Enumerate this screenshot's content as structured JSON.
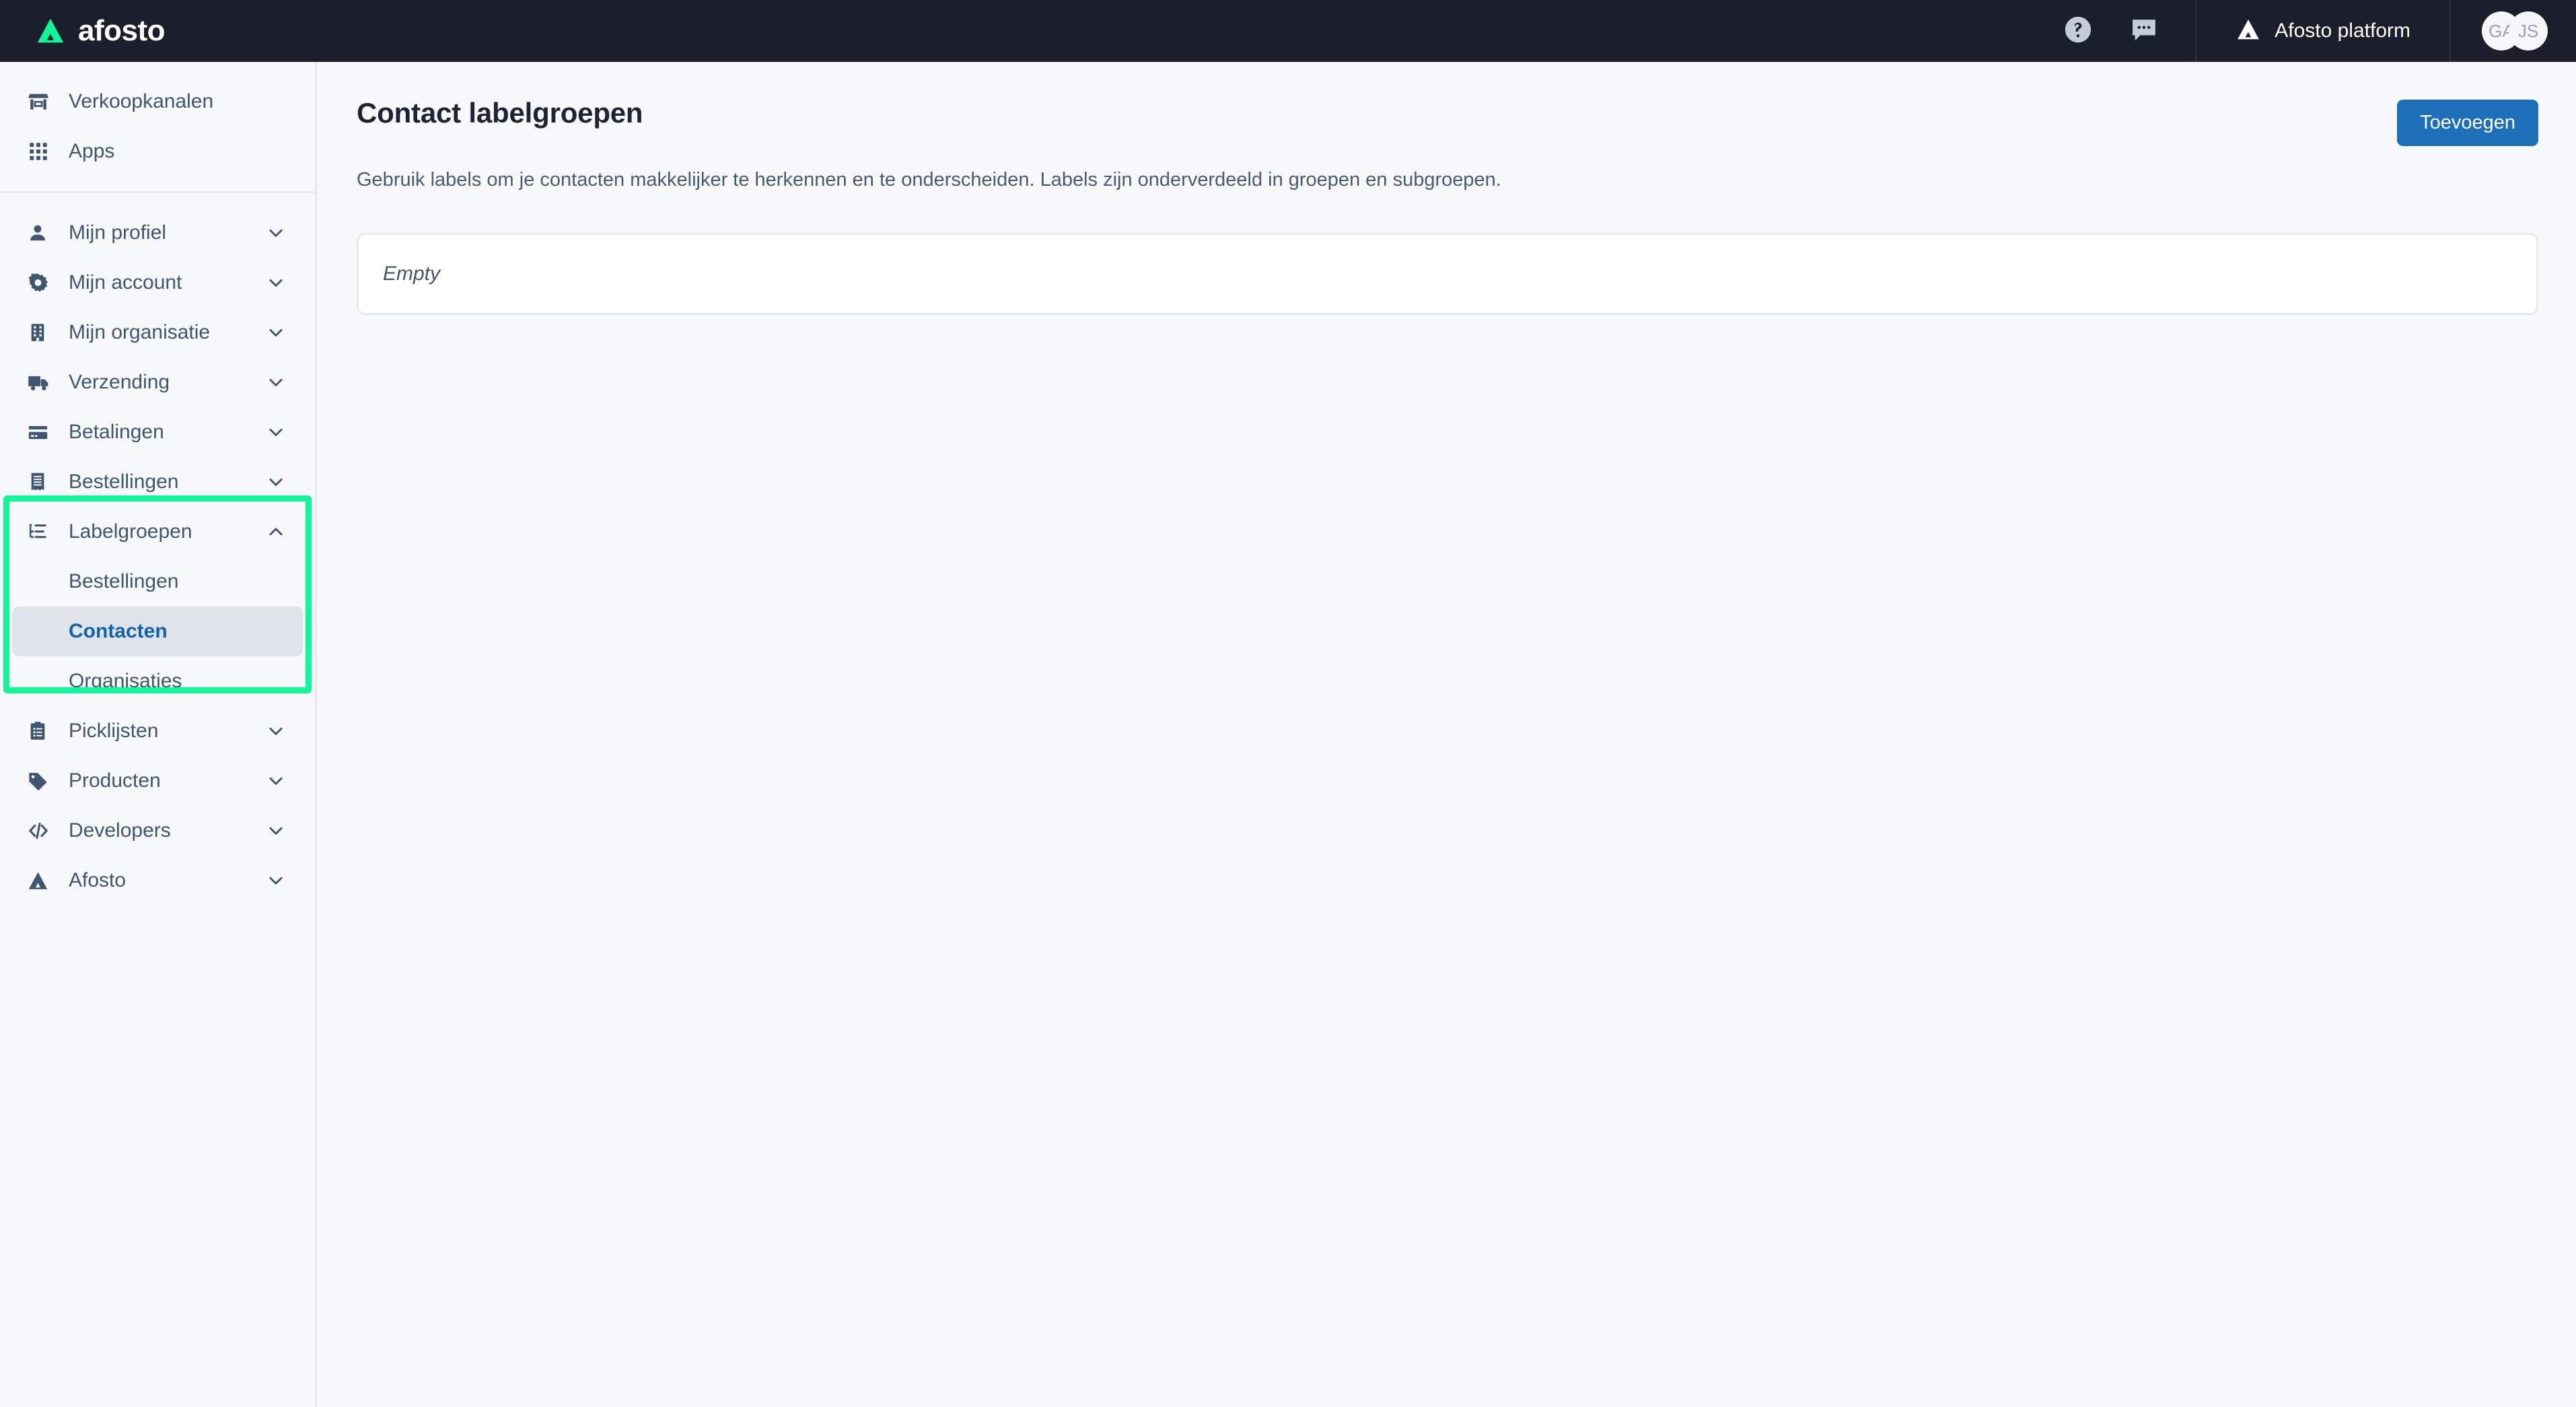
{
  "brand": {
    "name": "afosto",
    "logo_icon": "afosto-triangle-logo"
  },
  "topbar": {
    "help_icon": "help-circle-icon",
    "chat_icon": "chat-bubble-icon",
    "platform": {
      "label": "Afosto platform",
      "icon": "afosto-triangle-icon"
    },
    "avatars": [
      {
        "initials": "GA"
      },
      {
        "initials": "JS"
      }
    ]
  },
  "sidebar": {
    "groups": [
      {
        "items": [
          {
            "label": "Verkoopkanalen",
            "icon": "storefront-icon",
            "expandable": false
          },
          {
            "label": "Apps",
            "icon": "grid-apps-icon",
            "expandable": false
          }
        ]
      },
      {
        "items": [
          {
            "label": "Mijn profiel",
            "icon": "user-icon",
            "expandable": true,
            "chevron": "chevron-down-icon"
          },
          {
            "label": "Mijn account",
            "icon": "gear-icon",
            "expandable": true,
            "chevron": "chevron-down-icon"
          },
          {
            "label": "Mijn organisatie",
            "icon": "building-icon",
            "expandable": true,
            "chevron": "chevron-down-icon"
          },
          {
            "label": "Verzending",
            "icon": "truck-icon",
            "expandable": true,
            "chevron": "chevron-down-icon"
          },
          {
            "label": "Betalingen",
            "icon": "credit-card-icon",
            "expandable": true,
            "chevron": "chevron-down-icon"
          },
          {
            "label": "Bestellingen",
            "icon": "receipt-icon",
            "expandable": true,
            "chevron": "chevron-down-icon"
          },
          {
            "label": "Labelgroepen",
            "icon": "tree-list-icon",
            "expandable": true,
            "chevron": "chevron-up-icon",
            "expanded": true,
            "children": [
              {
                "label": "Bestellingen",
                "active": false
              },
              {
                "label": "Contacten",
                "active": true
              },
              {
                "label": "Organisaties",
                "active": false
              }
            ]
          },
          {
            "label": "Picklijsten",
            "icon": "clipboard-list-icon",
            "expandable": true,
            "chevron": "chevron-down-icon"
          },
          {
            "label": "Producten",
            "icon": "tag-icon",
            "expandable": true,
            "chevron": "chevron-down-icon"
          },
          {
            "label": "Developers",
            "icon": "code-icon",
            "expandable": true,
            "chevron": "chevron-down-icon"
          },
          {
            "label": "Afosto",
            "icon": "afosto-triangle-icon",
            "expandable": true,
            "chevron": "chevron-down-icon"
          }
        ]
      }
    ]
  },
  "main": {
    "title": "Contact labelgroepen",
    "description": "Gebruik labels om je contacten makkelijker te herkennen en te onderscheiden. Labels zijn onderverdeeld in groepen en subgroepen.",
    "add_button": "Toevoegen",
    "empty_state": "Empty"
  },
  "colors": {
    "topbar_bg": "#1a1f2b",
    "brand_green": "#10f79a",
    "accent_blue": "#1d6fb8",
    "active_link": "#1264a8",
    "active_bg": "#dfe3ea",
    "sidebar_text": "#3f5570",
    "page_bg": "#f7f8fa",
    "highlight_outline": "#10f79a"
  }
}
